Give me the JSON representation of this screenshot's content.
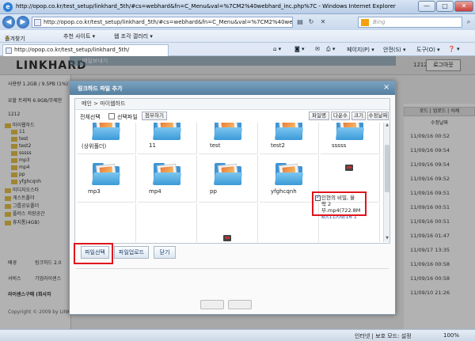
{
  "browser": {
    "window_title": "http://opop.co.kr/test_setup/linkhard_5th/#cs=webhard&fn=C_Menu&val=%7CM2%40webhard_inc.php%7C - Windows Internet Explorer",
    "url": "http://opop.co.kr/test_setup/linkhard_5th/#cs=webhard&fn=C_Menu&val=%7CM2%40webhard_inc.php%7C",
    "search_placeholder": "Bing",
    "favorites": [
      "즐겨찾기",
      "추천 사이트 ▾",
      "웹 조각 갤러리 ▾"
    ],
    "tab_label": "http://opop.co.kr/test_setup/linkhard_5th/",
    "command_items": [
      "페이지(P) ▾",
      "안전(S) ▾",
      "도구(O) ▾"
    ],
    "status_zone": "인터넷 | 보호 모드: 설정",
    "zoom": "100%"
  },
  "site": {
    "logo": "LINKHARD",
    "user_number": "1212",
    "logout_label": "로그아웃",
    "usage_line1": "사용량 1.2GB / 9.5PB (1%)",
    "usage_line2": "요할 트래픽 6.9GB/무제한",
    "left_num": "1212",
    "tree": [
      "마이웹하드",
      "11",
      "test",
      "test2",
      "sssss",
      "mp3",
      "mp4",
      "pp",
      "yfghcqnh",
      "미디지오스타",
      "게스트폴더",
      "그룹공유폴더",
      "플러스 저장공간",
      "휴지통(4GB)"
    ],
    "left_bottom": [
      "배경",
      "링크하드 2.0",
      "서비스",
      "기업라이센스",
      "라이센스구매 (회사자"
    ],
    "copyright": "Copyright © 2009 by LINKHARD",
    "bg_dialog_title": "메일보내기",
    "right_header": "로드 | 업로드 | 삭제",
    "right_subheader": "수정날짜",
    "dates": [
      "11/09/16 00:52",
      "11/09/16 09:54",
      "11/09/16 09:54",
      "11/09/16 09:52",
      "11/09/16 09:51",
      "11/09/16 00:51",
      "11/09/16 00:51",
      "11/09/16 01:47",
      "11/09/17 13:35",
      "11/09/16 00:58",
      "11/09/16 00:58",
      "11/09/10 21:26"
    ]
  },
  "dialog": {
    "title": "링크하드 파일 추가",
    "breadcrumb": "메인 > 마이웹하드",
    "select_all": "전체선택",
    "select_file": "선택파일",
    "attach_button": "첨부하기",
    "view_buttons": [
      "파일명",
      "다운수",
      "크기",
      "수정날짜"
    ],
    "items": [
      {
        "label": "(상위폴더)",
        "type": "folder"
      },
      {
        "label": "11",
        "type": "folder"
      },
      {
        "label": "test",
        "type": "folder"
      },
      {
        "label": "test2",
        "type": "folder"
      },
      {
        "label": "sssss",
        "type": "folder"
      },
      {
        "label": "mp3",
        "type": "folder"
      },
      {
        "label": "mp4",
        "type": "folder"
      },
      {
        "label": "pp",
        "type": "folder"
      },
      {
        "label": "yfghcqnh",
        "type": "folder"
      }
    ],
    "selected_file": {
      "line1": "인현의 비밀, 울",
      "line2": "락 2부.mp4(722.8M",
      "line3": "B)(11/09/16 1"
    },
    "bottom_buttons": [
      "파일선택",
      "파일업로드",
      "닫기"
    ]
  },
  "accent_colors": {
    "highlight_red": "#e0141b",
    "dialog_title": "#557f9f",
    "folder_blue": "#3f95d4"
  }
}
